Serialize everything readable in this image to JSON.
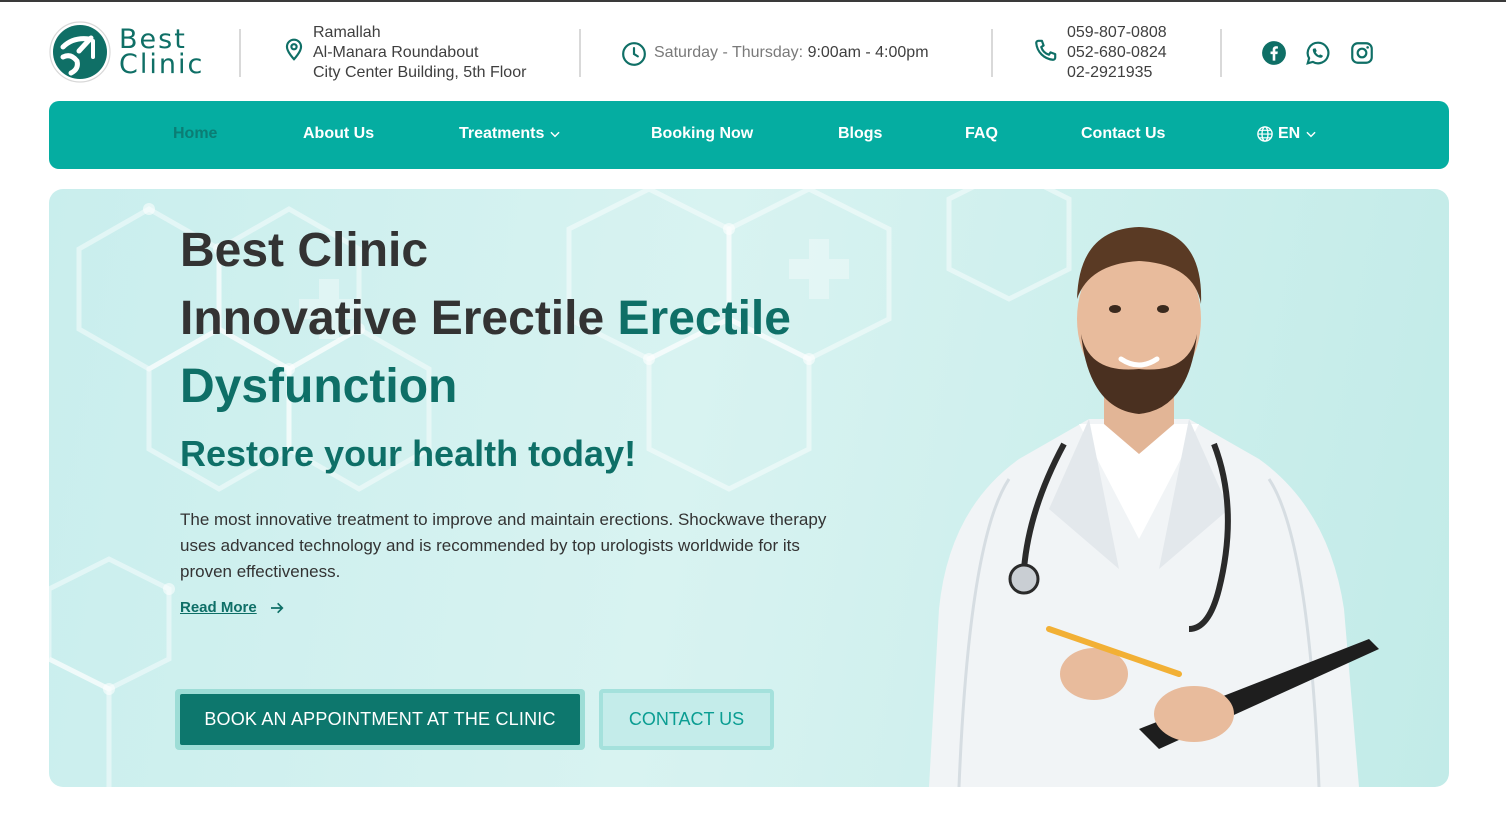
{
  "brand": {
    "line1": "Best",
    "line2": "Clinic"
  },
  "address": {
    "line1": "Ramallah",
    "line2": "Al-Manara Roundabout",
    "line3": "City Center Building, 5th Floor"
  },
  "hours": {
    "label": "Saturday - Thursday:",
    "time": "9:00am - 4:00pm"
  },
  "phones": [
    "059-807-0808",
    "052-680-0824",
    "02-2921935"
  ],
  "social": [
    "facebook-icon",
    "whatsapp-icon",
    "instagram-icon"
  ],
  "nav": {
    "home": "Home",
    "about": "About Us",
    "treatments": "Treatments",
    "booking": "Booking Now",
    "blogs": "Blogs",
    "faq": "FAQ",
    "contact": "Contact Us",
    "lang": "EN"
  },
  "hero": {
    "title1": "Best Clinic",
    "title2a": "Innovative Erectile ",
    "title2b": "Erectile",
    "title3": "Dysfunction",
    "subtitle": "Restore your health today!",
    "description": "The most innovative treatment to improve and maintain erections. Shockwave therapy uses advanced technology and is recommended by top urologists worldwide for its proven effectiveness.",
    "read_more": "Read More",
    "book_button": "BOOK AN APPOINTMENT AT THE CLINIC",
    "contact_button": "CONTACT US"
  },
  "colors": {
    "brand": "#0e6f67",
    "nav": "#05ada1",
    "button": "#0d776d"
  }
}
